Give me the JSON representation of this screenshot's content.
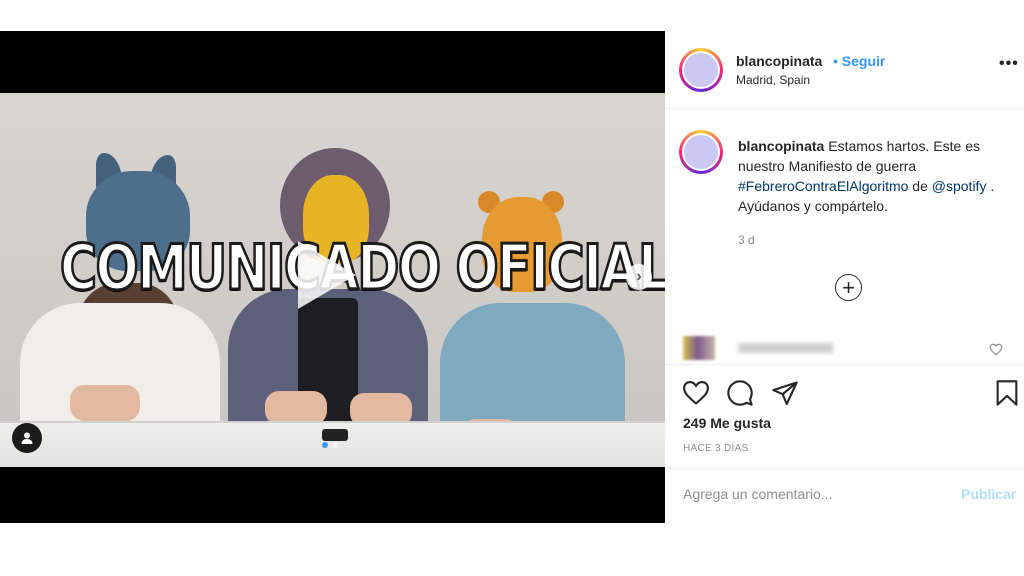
{
  "media": {
    "headline": "COMUNICADO OFICIAL",
    "icons": [
      "play-icon",
      "chevron-right-icon",
      "user-tag-icon"
    ],
    "carousel": {
      "total": 2,
      "active": 1
    }
  },
  "post": {
    "username": "blancopinata",
    "follow_label": "Seguir",
    "separator": "•",
    "location": "Madrid, Spain",
    "more_label": "•••"
  },
  "caption": {
    "username": "blancopinata",
    "text_1": "Estamos hartos. Este es nuestro Manifiesto de guerra",
    "hashtag": "#FebreroContraElAlgoritmo",
    "text_2": "de",
    "mention": "@spotify",
    "text_3": ". Ayúdanos y compártelo.",
    "age": "3 d"
  },
  "actions": {
    "likes": "249 Me gusta",
    "date": "HACE 3 DÍAS"
  },
  "comment": {
    "placeholder": "Agrega un comentario...",
    "publish_label": "Publicar"
  },
  "colors": {
    "link": "#3897f0",
    "publish_disabled": "#b2dffc",
    "muted": "#8e8e8e",
    "avatar_fill": "#ccc8f4"
  }
}
